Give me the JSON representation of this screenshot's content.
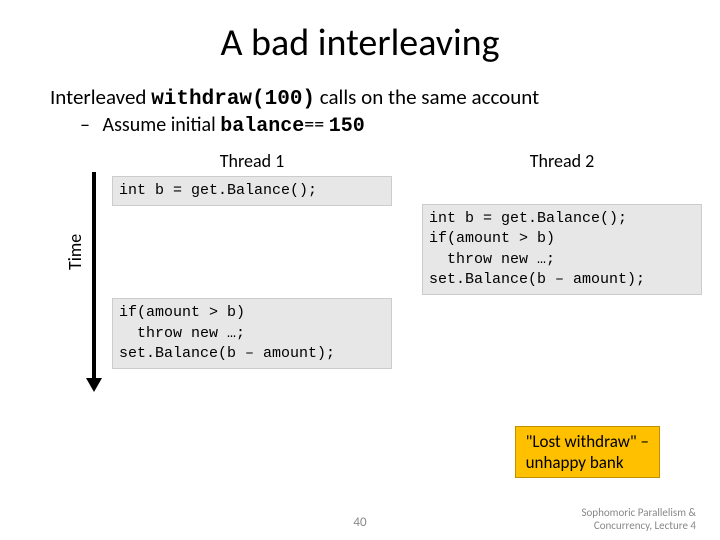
{
  "title": "A bad interleaving",
  "subtitle_pre": "Interleaved ",
  "subtitle_code": "withdraw(100)",
  "subtitle_post": " calls on the same account",
  "bullet_dash": "–",
  "bullet_pre": " Assume initial ",
  "bullet_code1": "balance",
  "bullet_mid": "== ",
  "bullet_code2": "150",
  "time_label": "Time",
  "thread1_header": "Thread 1",
  "thread2_header": "Thread 2",
  "t1_block1": "int b = get.Balance();",
  "t1_block2": "if(amount > b)\n  throw new …;\nset.Balance(b – amount);",
  "t2_block": "int b = get.Balance();\nif(amount > b)\n  throw new …;\nset.Balance(b – amount);",
  "callout_line1": "\"Lost withdraw\" –",
  "callout_line2": "unhappy bank",
  "page_number": "40",
  "footer_line1": "Sophomoric Parallelism &",
  "footer_line2": "Concurrency, Lecture 4"
}
